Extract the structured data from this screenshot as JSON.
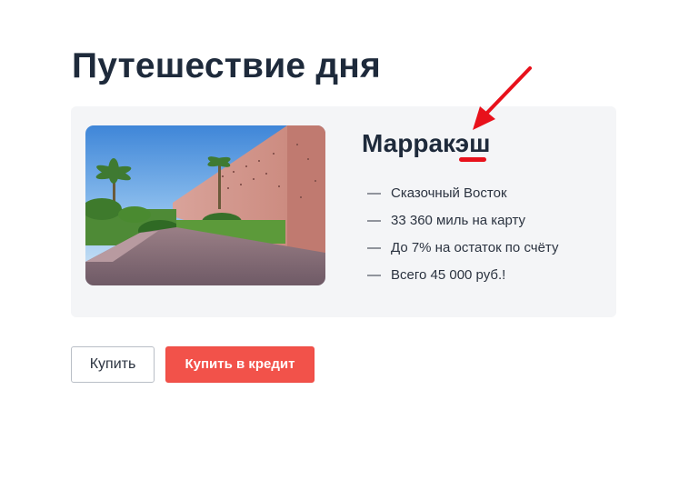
{
  "page": {
    "title": "Путешествие дня"
  },
  "offer": {
    "destination": "Марракэш",
    "features": [
      "Сказочный Восток",
      "33 360 миль на карту",
      "До 7% на остаток по счёту",
      "Всего 45 000 руб.!"
    ],
    "feature_marker": "—"
  },
  "actions": {
    "buy_label": "Купить",
    "credit_label": "Купить в кредит"
  },
  "colors": {
    "text": "#1e2a3b",
    "card_bg": "#f4f5f7",
    "primary": "#f2524a",
    "annotation": "#e8111b"
  },
  "icons": {
    "annotation": "red-arrow-icon"
  }
}
